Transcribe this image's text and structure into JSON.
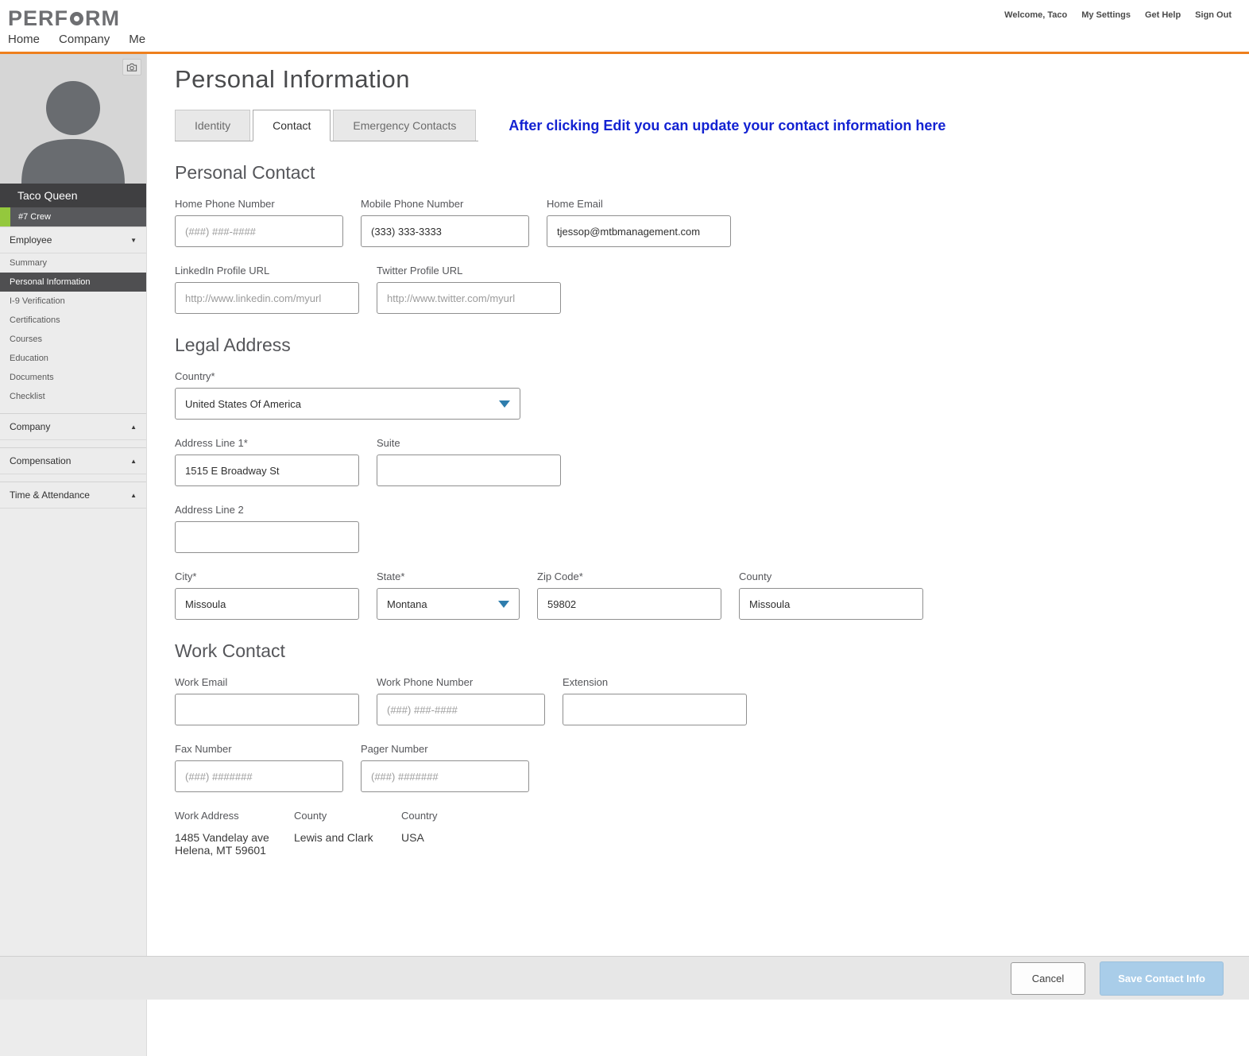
{
  "brand": {
    "logo_prefix": "PERF",
    "logo_suffix": "RM"
  },
  "header": {
    "welcome": "Welcome, Taco",
    "my_settings": "My Settings",
    "get_help": "Get Help",
    "sign_out": "Sign Out",
    "nav": [
      "Home",
      "Company",
      "Me"
    ]
  },
  "icons": {
    "chevron_down": "▼",
    "chevron_up": "▲"
  },
  "sidebar": {
    "user": {
      "name": "Taco Queen",
      "role": "#7 Crew"
    },
    "employee": {
      "label": "Employee",
      "items": [
        "Summary",
        "Personal Information",
        "I-9 Verification",
        "Certifications",
        "Courses",
        "Education",
        "Documents",
        "Checklist"
      ],
      "active_item": "Personal Information"
    },
    "collapsed_sections": [
      "Company",
      "Compensation",
      "Time & Attendance"
    ]
  },
  "main": {
    "title": "Personal Information",
    "tabs": [
      "Identity",
      "Contact",
      "Emergency Contacts"
    ],
    "active_tab": "Contact",
    "annotation": "After clicking Edit you can update your contact information here"
  },
  "form": {
    "personal_contact": {
      "heading": "Personal Contact",
      "home_phone": {
        "label": "Home Phone Number",
        "placeholder": "(###) ###-####",
        "value": ""
      },
      "mobile_phone": {
        "label": "Mobile Phone Number",
        "value": "(333) 333-3333"
      },
      "home_email": {
        "label": "Home Email",
        "value": "tjessop@mtbmanagement.com"
      },
      "linkedin": {
        "label": "LinkedIn Profile URL",
        "placeholder": "http://www.linkedin.com/myurl",
        "value": ""
      },
      "twitter": {
        "label": "Twitter Profile URL",
        "placeholder": "http://www.twitter.com/myurl",
        "value": ""
      }
    },
    "legal_address": {
      "heading": "Legal Address",
      "country": {
        "label": "Country*",
        "value": "United States Of America"
      },
      "address1": {
        "label": "Address Line 1*",
        "value": "1515 E Broadway St"
      },
      "suite": {
        "label": "Suite",
        "value": ""
      },
      "address2": {
        "label": "Address Line 2",
        "value": ""
      },
      "city": {
        "label": "City*",
        "value": "Missoula"
      },
      "state": {
        "label": "State*",
        "value": "Montana"
      },
      "zip": {
        "label": "Zip Code*",
        "value": "59802"
      },
      "county": {
        "label": "County",
        "value": "Missoula"
      }
    },
    "work_contact": {
      "heading": "Work Contact",
      "work_email": {
        "label": "Work Email",
        "value": ""
      },
      "work_phone": {
        "label": "Work Phone Number",
        "placeholder": "(###) ###-####",
        "value": ""
      },
      "extension": {
        "label": "Extension",
        "value": ""
      },
      "fax": {
        "label": "Fax Number",
        "placeholder": "(###) #######",
        "value": ""
      },
      "pager": {
        "label": "Pager Number",
        "placeholder": "(###) #######",
        "value": ""
      },
      "work_address": {
        "label": "Work Address",
        "line1": "1485 Vandelay ave",
        "line2": "Helena, MT 59601"
      },
      "work_county": {
        "label": "County",
        "value": "Lewis and Clark"
      },
      "work_country": {
        "label": "Country",
        "value": "USA"
      }
    }
  },
  "footer": {
    "cancel": "Cancel",
    "save": "Save Contact Info"
  }
}
